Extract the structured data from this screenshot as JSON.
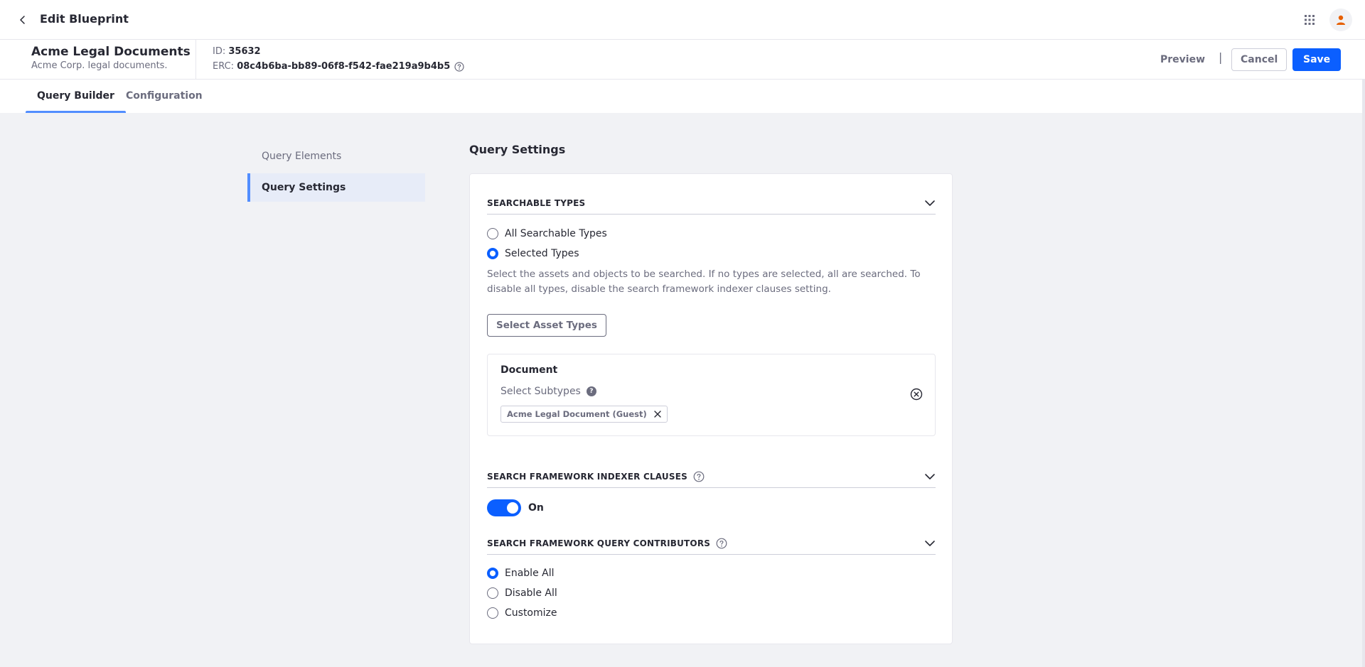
{
  "topbar": {
    "title": "Edit Blueprint",
    "back_icon": "chevron-left-icon",
    "apps_icon": "grid-icon",
    "avatar_icon": "user-icon"
  },
  "header": {
    "name": "Acme Legal Documents",
    "description": "Acme Corp. legal documents.",
    "id_label": "ID:",
    "id_value": "35632",
    "erc_label": "ERC:",
    "erc_value": "08c4b6ba-bb89-06f8-f542-fae219a9b4b5",
    "preview_label": "Preview",
    "separator": "|",
    "cancel_label": "Cancel",
    "save_label": "Save"
  },
  "tabs": [
    {
      "label": "Query Builder",
      "active": true
    },
    {
      "label": "Configuration",
      "active": false
    }
  ],
  "leftnav": {
    "items": [
      {
        "label": "Query Elements",
        "active": false
      },
      {
        "label": "Query Settings",
        "active": true
      }
    ]
  },
  "main": {
    "heading": "Query Settings",
    "searchable_types": {
      "title": "SEARCHABLE TYPES",
      "options": [
        {
          "label": "All Searchable Types",
          "checked": false
        },
        {
          "label": "Selected Types",
          "checked": true
        }
      ],
      "help": "Select the assets and objects to be searched. If no types are selected, all are searched. To disable all types, disable the search framework indexer clauses setting.",
      "select_button": "Select Asset Types",
      "document": {
        "title": "Document",
        "subtypes_label": "Select Subtypes",
        "help_glyph": "?",
        "chips": [
          "Acme Legal Document (Guest)"
        ]
      }
    },
    "indexer_clauses": {
      "title": "SEARCH FRAMEWORK INDEXER CLAUSES",
      "toggle_label": "On",
      "enabled": true
    },
    "query_contributors": {
      "title": "SEARCH FRAMEWORK QUERY CONTRIBUTORS",
      "options": [
        {
          "label": "Enable All",
          "checked": true
        },
        {
          "label": "Disable All",
          "checked": false
        },
        {
          "label": "Customize",
          "checked": false
        }
      ]
    }
  },
  "colors": {
    "primary": "#0b5fff",
    "accent": "#528eff",
    "text": "#272833",
    "secondary": "#6b6c7e",
    "avatar_icon": "#e65f00"
  }
}
